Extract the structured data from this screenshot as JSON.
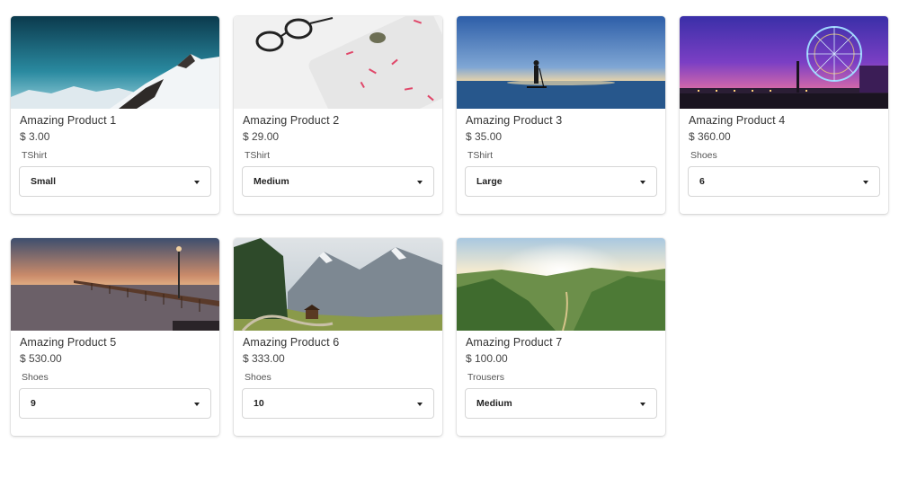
{
  "products": [
    {
      "name": "Amazing Product 1",
      "price": "$ 3.00",
      "option_label": "TShirt",
      "selected": "Small",
      "image": "snowy-mountain-photo"
    },
    {
      "name": "Amazing Product 2",
      "price": "$ 29.00",
      "option_label": "TShirt",
      "selected": "Medium",
      "image": "glasses-desk-photo"
    },
    {
      "name": "Amazing Product 3",
      "price": "$ 35.00",
      "option_label": "TShirt",
      "selected": "Large",
      "image": "paddleboard-sea-photo"
    },
    {
      "name": "Amazing Product 4",
      "price": "$ 360.00",
      "option_label": "Shoes",
      "selected": "6",
      "image": "ferris-wheel-pier-photo"
    },
    {
      "name": "Amazing Product 5",
      "price": "$ 530.00",
      "option_label": "Shoes",
      "selected": "9",
      "image": "pier-sunset-photo"
    },
    {
      "name": "Amazing Product 6",
      "price": "$ 333.00",
      "option_label": "Shoes",
      "selected": "10",
      "image": "alpine-valley-photo"
    },
    {
      "name": "Amazing Product 7",
      "price": "$ 100.00",
      "option_label": "Trousers",
      "selected": "Medium",
      "image": "green-hills-sunrise-photo"
    }
  ],
  "icons": {
    "select_caret": "chevron-down-icon"
  }
}
